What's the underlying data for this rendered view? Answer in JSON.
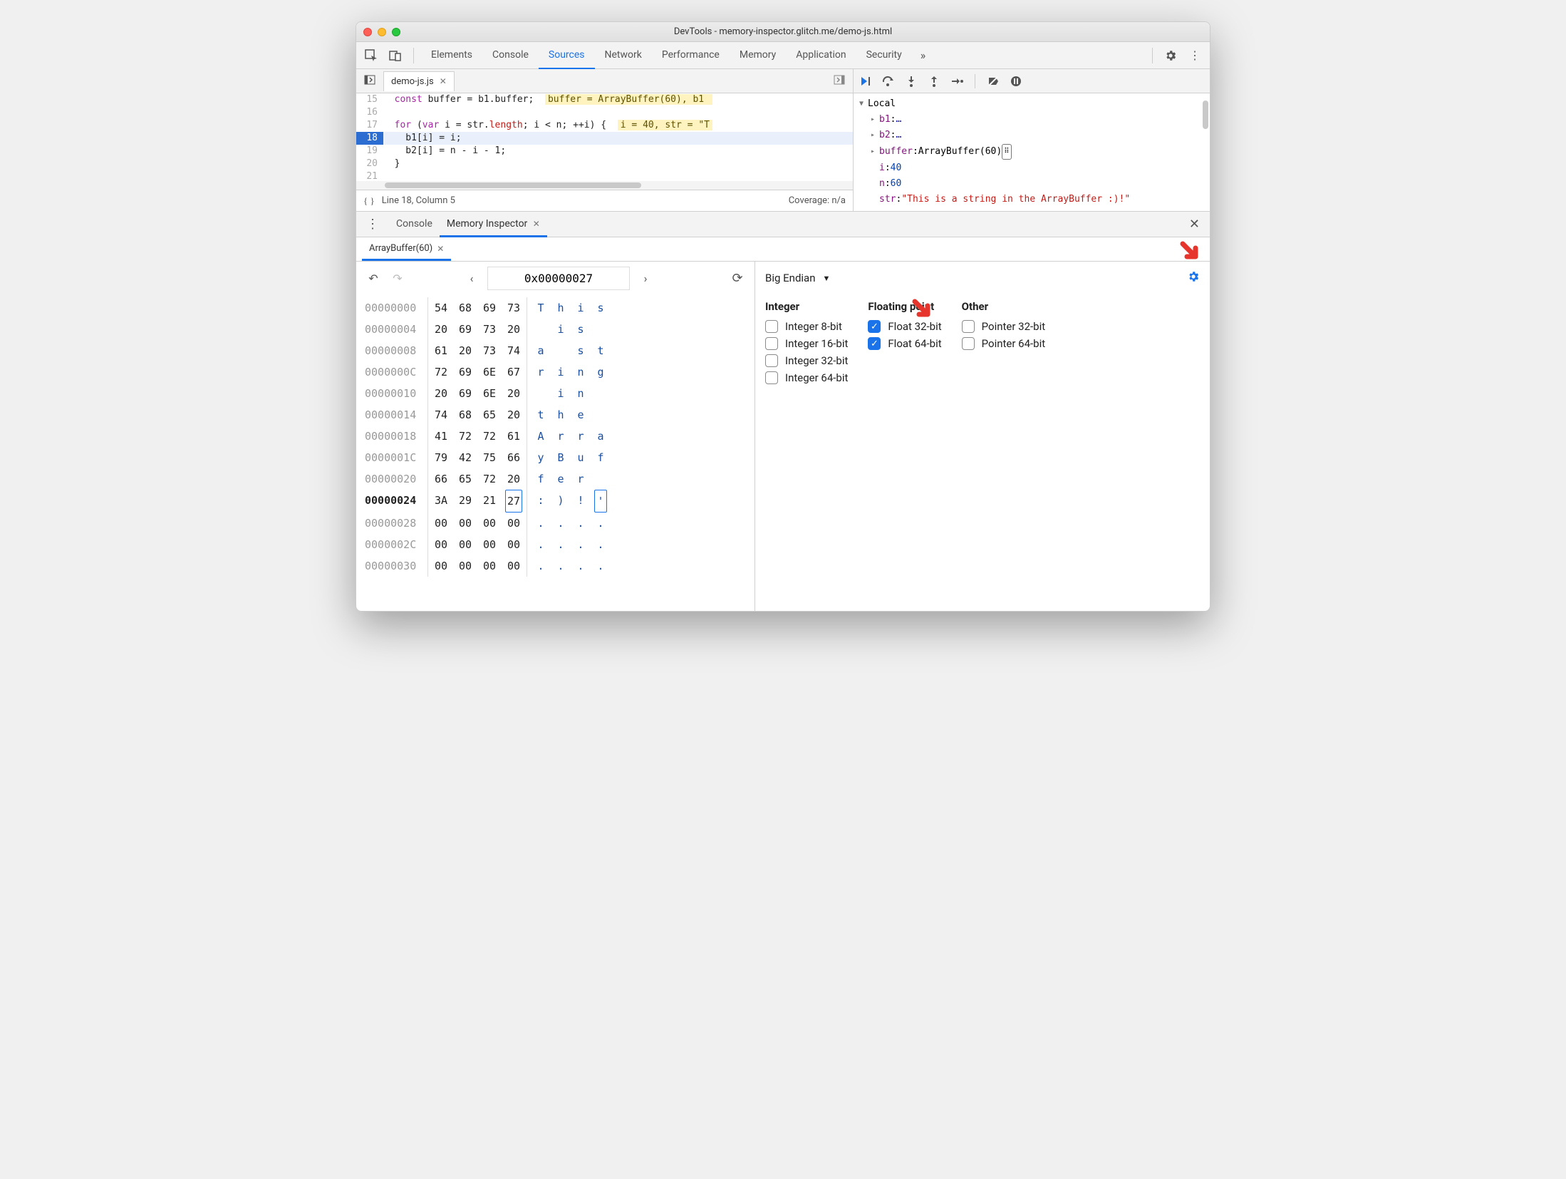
{
  "window": {
    "title": "DevTools - memory-inspector.glitch.me/demo-js.html"
  },
  "mainTabs": {
    "items": [
      "Elements",
      "Console",
      "Sources",
      "Network",
      "Performance",
      "Memory",
      "Application",
      "Security"
    ],
    "activeIndex": 2
  },
  "fileTab": {
    "name": "demo-js.js"
  },
  "code": {
    "lines": [
      {
        "n": 15,
        "html": "  <span class='kw'>const</span> buffer = b1.buffer;  <span class='inline-val'>buffer = ArrayBuffer(60), b1 </span>"
      },
      {
        "n": 16,
        "html": ""
      },
      {
        "n": 17,
        "html": "  <span class='kw'>for</span> (<span class='kw'>var</span> i = str.<span class='prop'>length</span>; i < n; ++i) {  <span class='inline-val'>i = 40, str = \"T</span>"
      },
      {
        "n": 18,
        "html": "    b1[i] = i;",
        "hl": true
      },
      {
        "n": 19,
        "html": "    b2[i] = n - i - 1;"
      },
      {
        "n": 20,
        "html": "  }"
      },
      {
        "n": 21,
        "html": ""
      }
    ],
    "status_left": "Line 18, Column 5",
    "status_right": "Coverage: n/a"
  },
  "scope": {
    "header": "Local",
    "rows": [
      {
        "indent": 1,
        "caret": "▸",
        "key": "b1",
        "val": "…",
        "valClass": "scope-val"
      },
      {
        "indent": 1,
        "caret": "▸",
        "key": "b2",
        "val": "…",
        "valClass": "scope-val"
      },
      {
        "indent": 1,
        "caret": "▸",
        "key": "buffer",
        "val": "ArrayBuffer(60)",
        "valClass": "",
        "icon": true
      },
      {
        "indent": 1,
        "caret": "",
        "key": "i",
        "val": "40",
        "valClass": "scope-num"
      },
      {
        "indent": 1,
        "caret": "",
        "key": "n",
        "val": "60",
        "valClass": "scope-num"
      },
      {
        "indent": 1,
        "caret": "",
        "key": "str",
        "val": "\"This is a string in the ArrayBuffer :)!\"",
        "valClass": "scope-str"
      }
    ]
  },
  "drawer": {
    "tabs": [
      "Console",
      "Memory Inspector"
    ],
    "activeIndex": 1,
    "subTab": "ArrayBuffer(60)"
  },
  "memoryInspector": {
    "address": "0x00000027",
    "hexRows": [
      {
        "addr": "00000000",
        "bytes": [
          "54",
          "68",
          "69",
          "73"
        ],
        "ascii": [
          "T",
          "h",
          "i",
          "s"
        ]
      },
      {
        "addr": "00000004",
        "bytes": [
          "20",
          "69",
          "73",
          "20"
        ],
        "ascii": [
          " ",
          "i",
          "s",
          " "
        ]
      },
      {
        "addr": "00000008",
        "bytes": [
          "61",
          "20",
          "73",
          "74"
        ],
        "ascii": [
          "a",
          " ",
          "s",
          "t"
        ]
      },
      {
        "addr": "0000000C",
        "bytes": [
          "72",
          "69",
          "6E",
          "67"
        ],
        "ascii": [
          "r",
          "i",
          "n",
          "g"
        ]
      },
      {
        "addr": "00000010",
        "bytes": [
          "20",
          "69",
          "6E",
          "20"
        ],
        "ascii": [
          " ",
          "i",
          "n",
          " "
        ]
      },
      {
        "addr": "00000014",
        "bytes": [
          "74",
          "68",
          "65",
          "20"
        ],
        "ascii": [
          "t",
          "h",
          "e",
          " "
        ]
      },
      {
        "addr": "00000018",
        "bytes": [
          "41",
          "72",
          "72",
          "61"
        ],
        "ascii": [
          "A",
          "r",
          "r",
          "a"
        ]
      },
      {
        "addr": "0000001C",
        "bytes": [
          "79",
          "42",
          "75",
          "66"
        ],
        "ascii": [
          "y",
          "B",
          "u",
          "f"
        ]
      },
      {
        "addr": "00000020",
        "bytes": [
          "66",
          "65",
          "72",
          "20"
        ],
        "ascii": [
          "f",
          "e",
          "r",
          " "
        ]
      },
      {
        "addr": "00000024",
        "bytes": [
          "3A",
          "29",
          "21",
          "27"
        ],
        "ascii": [
          ":",
          ")",
          "!",
          "'"
        ],
        "boldAddr": true,
        "boxByteIndex": 3,
        "boxAsciiIndex": 3
      },
      {
        "addr": "00000028",
        "bytes": [
          "00",
          "00",
          "00",
          "00"
        ],
        "ascii": [
          ".",
          ".",
          ".",
          "."
        ]
      },
      {
        "addr": "0000002C",
        "bytes": [
          "00",
          "00",
          "00",
          "00"
        ],
        "ascii": [
          ".",
          ".",
          ".",
          "."
        ]
      },
      {
        "addr": "00000030",
        "bytes": [
          "00",
          "00",
          "00",
          "00"
        ],
        "ascii": [
          ".",
          ".",
          ".",
          "."
        ]
      }
    ],
    "endian": "Big Endian",
    "typeGroups": [
      {
        "title": "Integer",
        "opts": [
          {
            "label": "Integer 8-bit",
            "checked": false
          },
          {
            "label": "Integer 16-bit",
            "checked": false
          },
          {
            "label": "Integer 32-bit",
            "checked": false
          },
          {
            "label": "Integer 64-bit",
            "checked": false
          }
        ]
      },
      {
        "title": "Floating point",
        "opts": [
          {
            "label": "Float 32-bit",
            "checked": true
          },
          {
            "label": "Float 64-bit",
            "checked": true
          }
        ]
      },
      {
        "title": "Other",
        "opts": [
          {
            "label": "Pointer 32-bit",
            "checked": false
          },
          {
            "label": "Pointer 64-bit",
            "checked": false
          }
        ]
      }
    ]
  }
}
